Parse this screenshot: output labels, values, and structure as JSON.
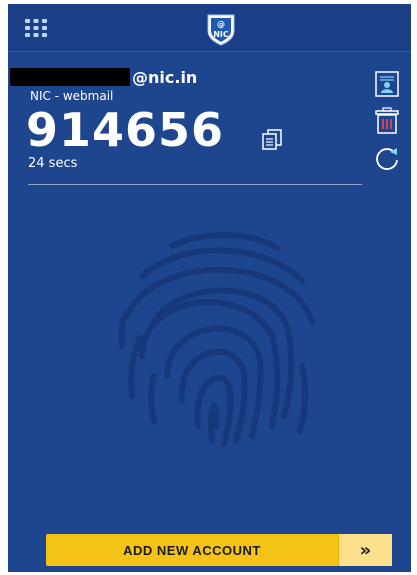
{
  "header": {
    "menu_icon": "grid-icon",
    "logo_text": "NIC",
    "logo_at": "@"
  },
  "account": {
    "email_domain": "@nic.in",
    "provider": "NIC - webmail",
    "otp": "914656",
    "timer": "24 secs"
  },
  "actions": {
    "add_account_label": "ADD NEW ACCOUNT",
    "add_account_arrow": "»"
  },
  "icons": {
    "copy": "copy-icon",
    "details": "user-card-icon",
    "delete": "trash-icon",
    "refresh": "refresh-icon",
    "background": "fingerprint-icon"
  },
  "colors": {
    "background": "#1d468f",
    "topbar": "#1a3f86",
    "button": "#f5c317",
    "delete_accent": "#e0455a"
  }
}
